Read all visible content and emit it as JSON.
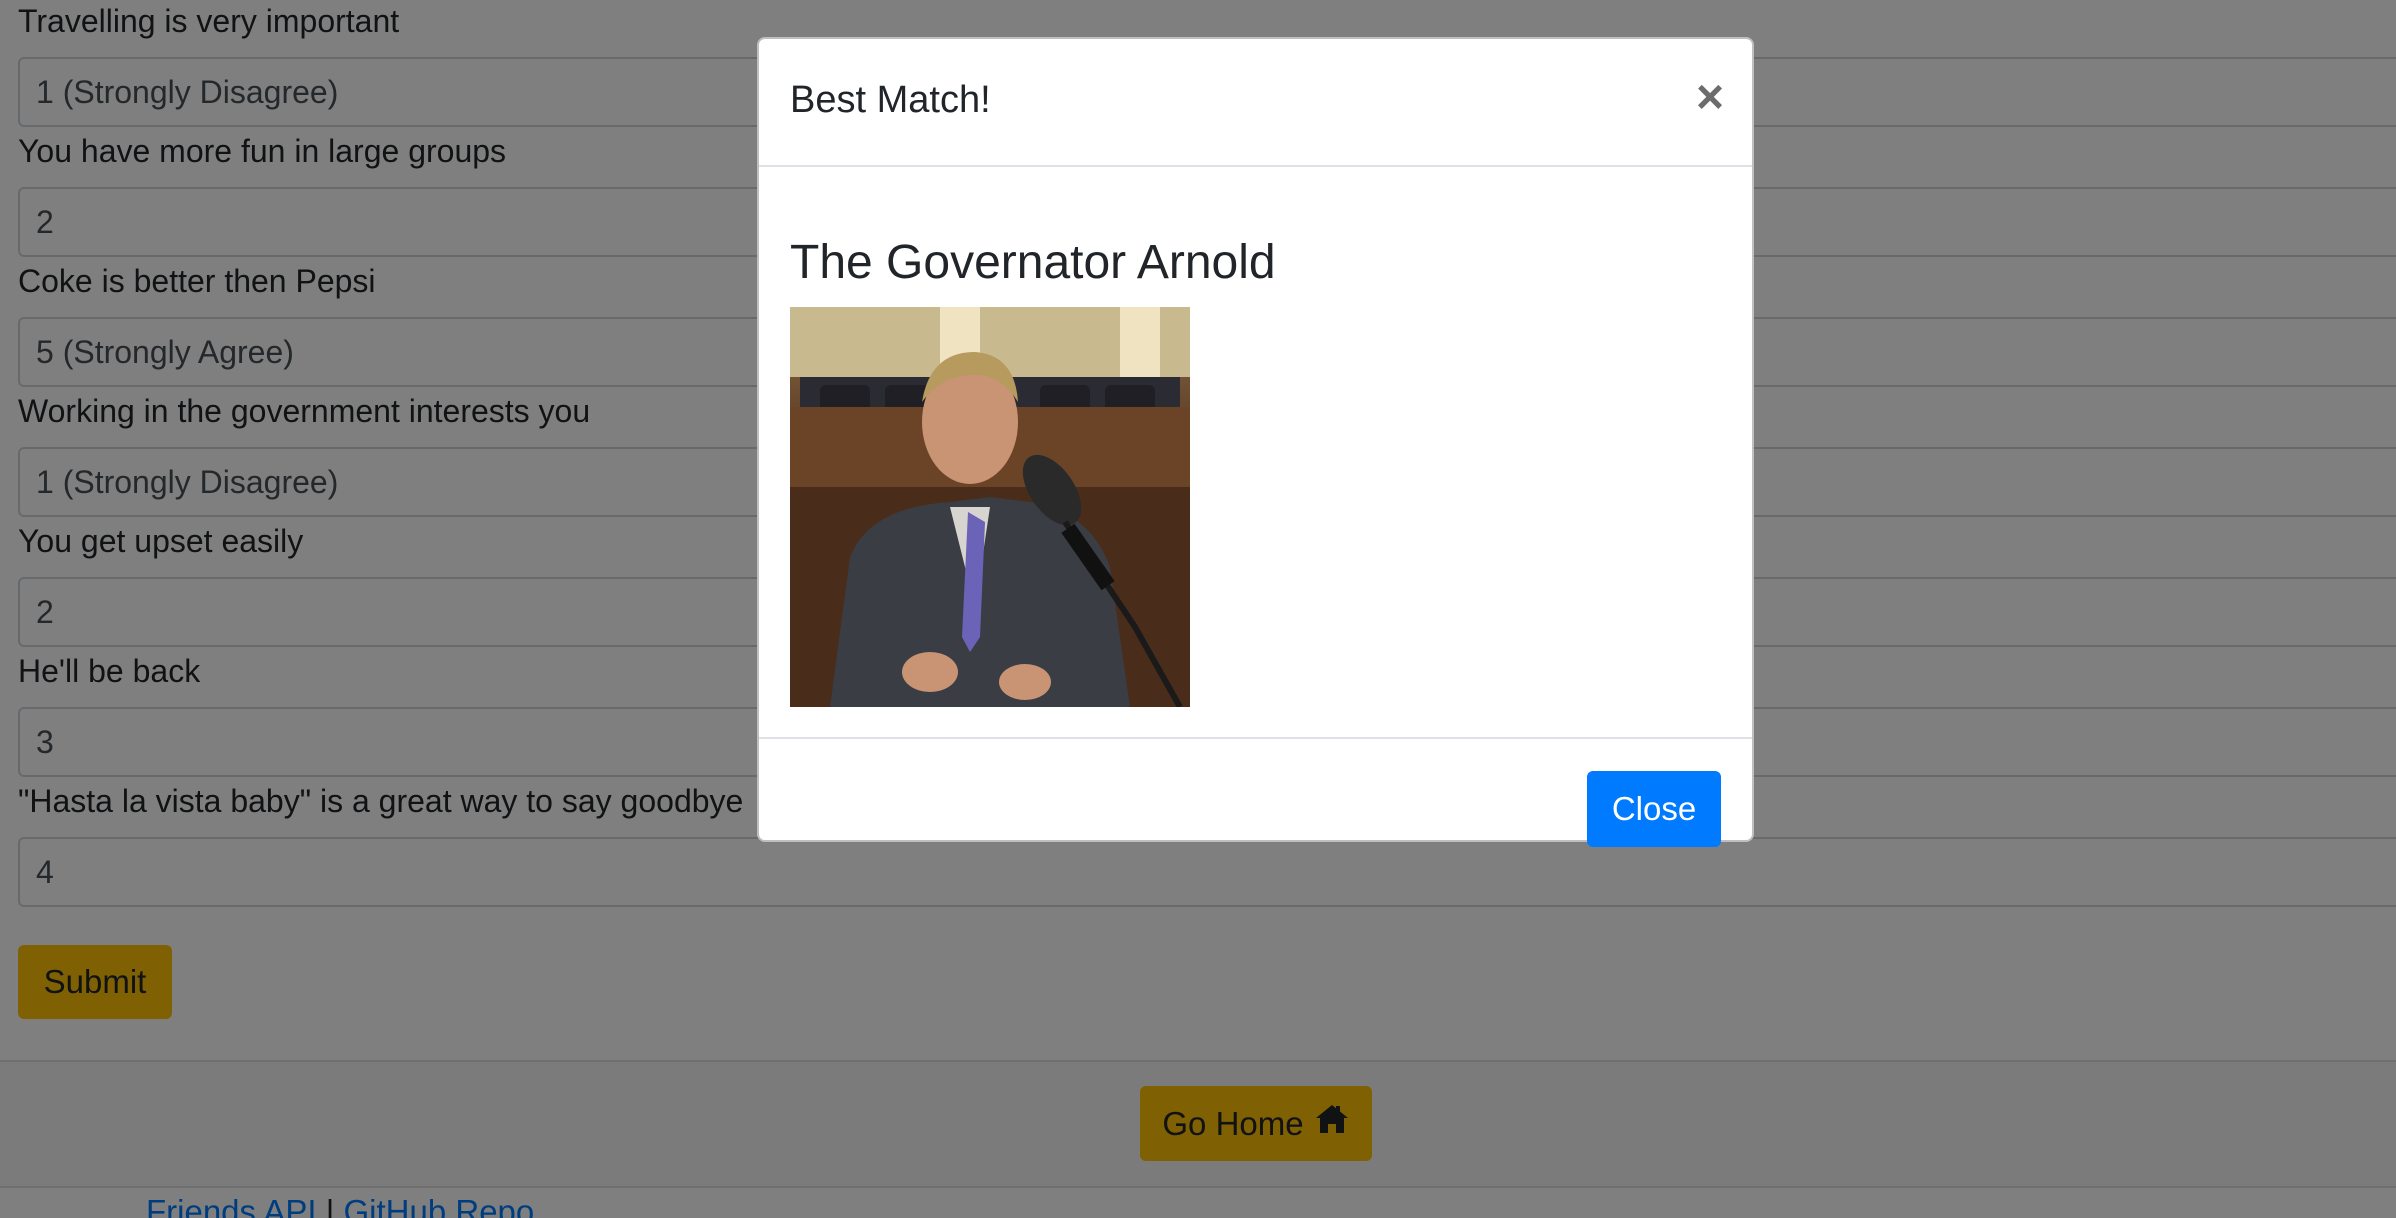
{
  "survey": {
    "questions": [
      {
        "label": "Travelling is very important",
        "value": "1 (Strongly Disagree)"
      },
      {
        "label": "You have more fun in large groups",
        "value": "2"
      },
      {
        "label": "Coke is better then Pepsi",
        "value": "5 (Strongly Agree)"
      },
      {
        "label": "Working in the government interests you",
        "value": "1 (Strongly Disagree)"
      },
      {
        "label": "You get upset easily",
        "value": "2"
      },
      {
        "label": "He'll be back",
        "value": "3"
      },
      {
        "label": "\"Hasta la vista baby\" is a great way to say goodbye",
        "value": "4"
      }
    ],
    "submit_label": "Submit"
  },
  "footer": {
    "home_label": "Go Home",
    "home_icon": "home-icon",
    "links": [
      "Friends API",
      "GitHub Repo"
    ],
    "separator": "|"
  },
  "modal": {
    "title": "Best Match!",
    "close_x": "×",
    "match_name": "The Governator Arnold",
    "close_label": "Close"
  },
  "colors": {
    "accent_primary": "#007bff",
    "accent_warning": "#ffc107",
    "backdrop": "rgba(0,0,0,0.5)"
  }
}
